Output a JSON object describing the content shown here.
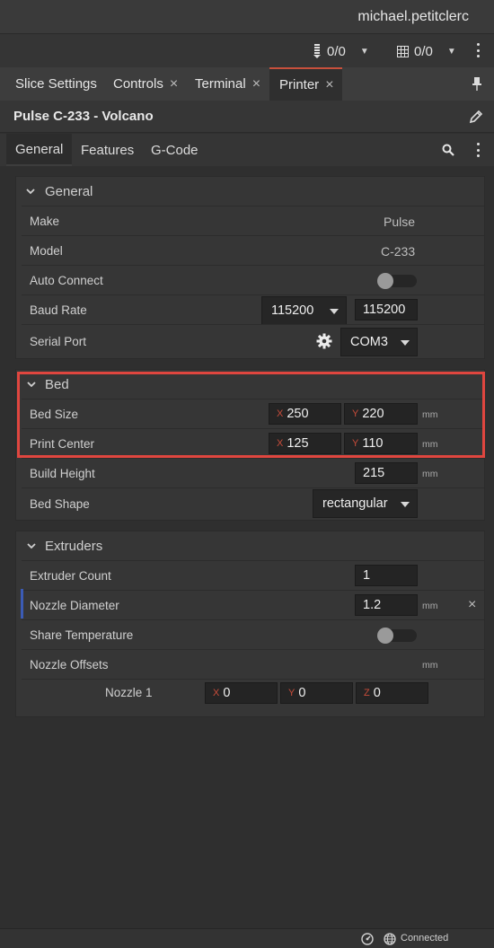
{
  "header": {
    "username": "michael.petitclerc"
  },
  "status": {
    "extruder_count_text": "0/0",
    "layer_count_text": "0/0"
  },
  "tabs": [
    {
      "label": "Slice Settings",
      "closable": false
    },
    {
      "label": "Controls",
      "closable": true
    },
    {
      "label": "Terminal",
      "closable": true
    },
    {
      "label": "Printer",
      "closable": true,
      "active": true
    }
  ],
  "tab_close_glyph": "×",
  "printer_title": "Pulse C-233 - Volcano",
  "subtabs": [
    "General",
    "Features",
    "G-Code"
  ],
  "sections": {
    "general": {
      "title": "General",
      "make_label": "Make",
      "make_value": "Pulse",
      "model_label": "Model",
      "model_value": "C-233",
      "auto_connect_label": "Auto Connect",
      "auto_connect_on": false,
      "baud_rate_label": "Baud Rate",
      "baud_rate_select": "115200",
      "baud_rate_value": "115200",
      "serial_port_label": "Serial Port",
      "serial_port_value": "COM3"
    },
    "bed": {
      "title": "Bed",
      "bed_size_label": "Bed Size",
      "bed_size_x": "250",
      "bed_size_y": "220",
      "print_center_label": "Print Center",
      "print_center_x": "125",
      "print_center_y": "110",
      "build_height_label": "Build Height",
      "build_height_value": "215",
      "bed_shape_label": "Bed Shape",
      "bed_shape_value": "rectangular"
    },
    "extruders": {
      "title": "Extruders",
      "extruder_count_label": "Extruder Count",
      "extruder_count_value": "1",
      "nozzle_diameter_label": "Nozzle Diameter",
      "nozzle_diameter_value": "1.2",
      "share_temperature_label": "Share Temperature",
      "share_temperature_on": false,
      "nozzle_offsets_label": "Nozzle Offsets",
      "nozzle1_label": "Nozzle 1",
      "nozzle1_x": "0",
      "nozzle1_y": "0",
      "nozzle1_z": "0"
    }
  },
  "axes": {
    "x": "X",
    "y": "Y",
    "z": "Z"
  },
  "unit_mm": "mm",
  "clear_glyph": "×",
  "footer": {
    "connection_status": "Connected"
  },
  "colors": {
    "accent": "#c8503c",
    "highlight_box": "#e0463f",
    "modified_indicator": "#3b5bb5"
  }
}
